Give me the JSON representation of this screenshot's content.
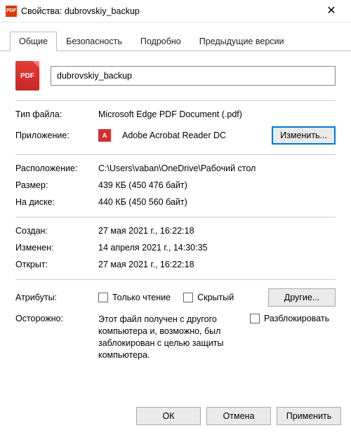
{
  "window": {
    "title": "Свойства: dubrovskiy_backup",
    "pdf_icon_text": "PDF"
  },
  "tabs": {
    "general": "Общие",
    "security": "Безопасность",
    "details": "Подробно",
    "previous": "Предыдущие версии"
  },
  "file": {
    "name_value": "dubrovskiy_backup",
    "type_label": "Тип файла:",
    "type_value": "Microsoft Edge PDF Document (.pdf)",
    "app_label": "Приложение:",
    "app_value": "Adobe Acrobat Reader DC",
    "change_btn": "Изменить...",
    "location_label": "Расположение:",
    "location_value": "C:\\Users\\vaban\\OneDrive\\Рабочий стол",
    "size_label": "Размер:",
    "size_value": "439 КБ (450 476 байт)",
    "ondisk_label": "На диске:",
    "ondisk_value": "440 КБ (450 560 байт)",
    "created_label": "Создан:",
    "created_value": "27 мая 2021 г., 16:22:18",
    "modified_label": "Изменен:",
    "modified_value": "14 апреля 2021 г., 14:30:35",
    "accessed_label": "Открыт:",
    "accessed_value": "27 мая 2021 г., 16:22:18"
  },
  "attributes": {
    "label": "Атрибуты:",
    "readonly": "Только чтение",
    "hidden": "Скрытый",
    "advanced_btn": "Другие..."
  },
  "security": {
    "label": "Осторожно:",
    "text": "Этот файл получен с другого компьютера и, возможно, был заблокирован с целью защиты компьютера.",
    "unblock": "Разблокировать"
  },
  "footer": {
    "ok": "ОК",
    "cancel": "Отмена",
    "apply": "Применить"
  }
}
